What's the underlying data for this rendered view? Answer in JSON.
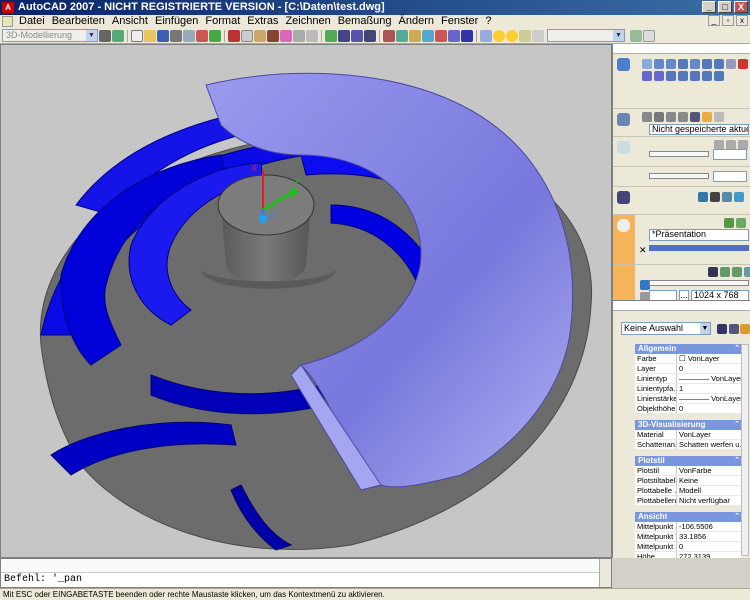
{
  "window": {
    "title": "AutoCAD 2007 - NICHT REGISTRIERTE VERSION - [C:\\Daten\\test.dwg]",
    "min_label": "_",
    "max_label": "□",
    "close_label": "X"
  },
  "menubar": {
    "items": [
      "Datei",
      "Bearbeiten",
      "Ansicht",
      "Einfügen",
      "Format",
      "Extras",
      "Zeichnen",
      "Bemaßung",
      "Ändern",
      "Fenster",
      "?"
    ]
  },
  "toolbar": {
    "workspace": "3D-Modellierung"
  },
  "dashboard": {
    "view_select": "Nicht gespeicherte aktuelle Ansicht",
    "visual_style": "*Präsentation",
    "resolution": "1024 x 768",
    "ellipsis": "..."
  },
  "properties": {
    "selection": "Keine Auswahl",
    "categories": [
      {
        "name": "Allgemein",
        "rows": [
          {
            "k": "Farbe",
            "v": "VonLayer"
          },
          {
            "k": "Layer",
            "v": "0"
          },
          {
            "k": "Linientyp",
            "v": "———— VonLayer"
          },
          {
            "k": "Linientypfa...",
            "v": "1"
          },
          {
            "k": "Linienstärke",
            "v": "———— VonLayer"
          },
          {
            "k": "Objekthöhe",
            "v": "0"
          }
        ]
      },
      {
        "name": "3D-Visualisierung",
        "rows": [
          {
            "k": "Material",
            "v": "VonLayer"
          },
          {
            "k": "Schattenan...",
            "v": "Schatten werfen u..."
          }
        ]
      },
      {
        "name": "Plotstil",
        "rows": [
          {
            "k": "Plotstil",
            "v": "VonFarbe"
          },
          {
            "k": "Plotstiltabelle",
            "v": "Keine"
          },
          {
            "k": "Plottabelle ...",
            "v": "Modell"
          },
          {
            "k": "Plottabellen...",
            "v": "Nicht verfügbar"
          }
        ]
      },
      {
        "name": "Ansicht",
        "rows": [
          {
            "k": "Mittelpunkt X",
            "v": "-106.5506"
          },
          {
            "k": "Mittelpunkt Y",
            "v": "33.1856"
          },
          {
            "k": "Mittelpunkt Z",
            "v": "0"
          },
          {
            "k": "Höhe",
            "v": "272.3139"
          }
        ]
      }
    ]
  },
  "ucs": {
    "x": "X",
    "y": "Y",
    "z": "Z"
  },
  "command": {
    "line": "Befehl: '_pan"
  },
  "status": {
    "text": "Mit ESC oder EINGABETASTE beenden oder rechte Maustaste klicken, um das Kontextmenü zu aktivieren."
  },
  "colors": {
    "blade_blue": "#0000e0",
    "shroud_lavender": "#8a8ae8",
    "hub_gray": "#6a6a6a",
    "viewport_bg": "#c6c6c6"
  }
}
